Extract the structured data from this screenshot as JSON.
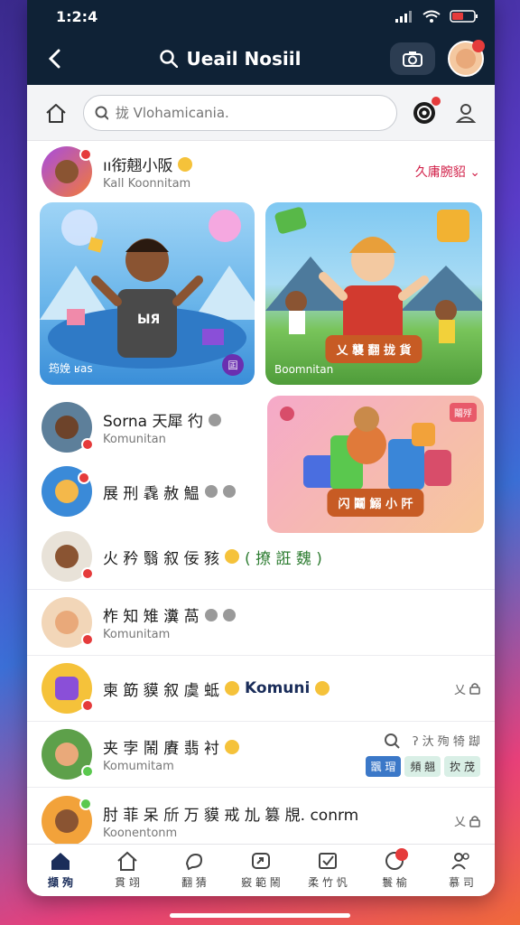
{
  "status": {
    "time": "1:2:4"
  },
  "appbar": {
    "title": "Ueail Nosiil"
  },
  "search": {
    "placeholder": "拢 Vlohamicania."
  },
  "feature": {
    "title": "ıı衔翹小阪",
    "subtitle": "Kall Koonnitam",
    "action": "久庸腕貂",
    "cards": [
      {
        "label": "筠娩 ʁas",
        "shirt": "ЫЯ",
        "tag": "囸"
      },
      {
        "label": "Boomnitan",
        "banner": "乂 襲 翻 拢 貨"
      }
    ]
  },
  "side_card": {
    "badge": "鬮殍",
    "banner": "闪 鬮 鰯 小 阡"
  },
  "list": [
    {
      "name": "Sorna 天犀 彴",
      "sub": "Komunitan"
    },
    {
      "name": "展 刑 毳 赦 鰛",
      "sub": ""
    },
    {
      "name": "火 矜 翳 叙 佞 豥",
      "sub": "",
      "extra": "( 撩 誑 魏 )"
    },
    {
      "name": "柞 知 雉 瀵 萵",
      "sub": "Komunitam"
    },
    {
      "name": "柬 筯 貘 叙 虞 蚳",
      "sub": "",
      "extra": "Komuni",
      "action": "乂"
    },
    {
      "name": "夹 孛 鬧 賡 翡 衬",
      "sub": "Komumitam",
      "action": "ʔ 汏 殉 犄 踋",
      "tabs": [
        "飁 瑁",
        "頻 翹",
        "扻 茂"
      ]
    },
    {
      "name": "肘 菲 呆 斦 万 貘 戒 劜 篡 覑. conrm",
      "sub": "Koonentonm",
      "action": "乂"
    }
  ],
  "tabs": [
    {
      "label": "擷 殉",
      "icon": "home-icon"
    },
    {
      "label": "貫 翊",
      "icon": "house-icon"
    },
    {
      "label": "翻 猜",
      "icon": "bird-icon"
    },
    {
      "label": "竅 範 鬧",
      "icon": "share-icon"
    },
    {
      "label": "柔 竹 忛",
      "icon": "check-box-icon"
    },
    {
      "label": "鬟 榆",
      "icon": "notification-icon"
    },
    {
      "label": "慕 司",
      "icon": "people-icon"
    }
  ],
  "colors": {
    "nav": "#0f2236",
    "accent": "#d2234b",
    "badge": "#e53b3b"
  }
}
